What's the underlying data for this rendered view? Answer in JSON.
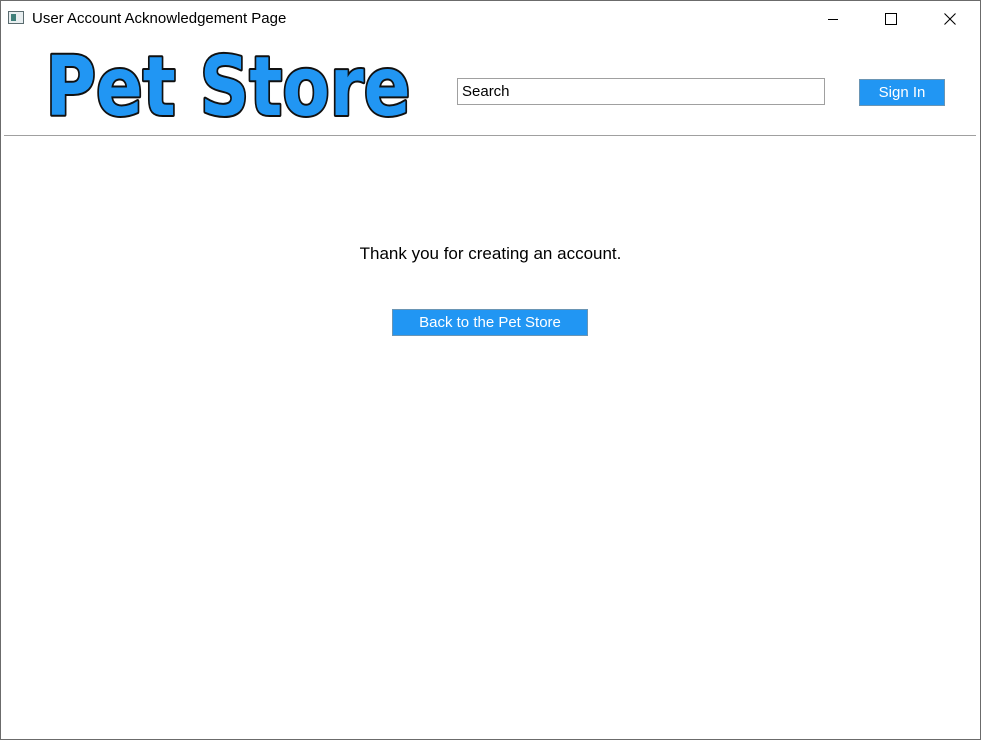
{
  "window": {
    "title": "User Account Acknowledgement Page"
  },
  "header": {
    "logo_text": "Pet Store",
    "search": {
      "value": "Search",
      "placeholder": ""
    },
    "signin_label": "Sign In"
  },
  "main": {
    "message": "Thank you for creating an account.",
    "back_label": "Back to the Pet Store"
  },
  "colors": {
    "accent": "#2196f3",
    "logo_fill": "#2196f3",
    "logo_outline": "#111111"
  },
  "icons": {
    "app": "app-window-icon",
    "minimize": "minimize-icon",
    "maximize": "maximize-icon",
    "close": "close-icon"
  }
}
